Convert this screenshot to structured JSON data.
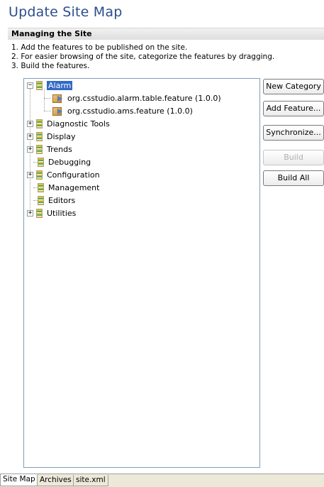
{
  "page": {
    "title": "Update Site Map"
  },
  "section": {
    "title": "Managing the Site",
    "instructions": [
      "1. Add the features to be published on the site.",
      "2. For easier browsing of the site, categorize the features by dragging.",
      "3. Build the features."
    ]
  },
  "tree": {
    "items": [
      {
        "label": "Alarm",
        "type": "category",
        "expander": "−",
        "selected": true
      },
      {
        "label": "org.csstudio.alarm.table.feature (1.0.0)",
        "type": "feature"
      },
      {
        "label": "org.csstudio.ams.feature (1.0.0)",
        "type": "feature"
      },
      {
        "label": "Diagnostic Tools",
        "type": "category",
        "expander": "+"
      },
      {
        "label": "Display",
        "type": "category",
        "expander": "+"
      },
      {
        "label": "Trends",
        "type": "category",
        "expander": "+"
      },
      {
        "label": "Debugging",
        "type": "category",
        "expander": ""
      },
      {
        "label": "Configuration",
        "type": "category",
        "expander": "+"
      },
      {
        "label": "Management",
        "type": "category",
        "expander": ""
      },
      {
        "label": "Editors",
        "type": "category",
        "expander": ""
      },
      {
        "label": "Utilities",
        "type": "category",
        "expander": "+"
      }
    ]
  },
  "buttons": {
    "new_category": "New Category",
    "add_feature": "Add Feature...",
    "synchronize": "Synchronize...",
    "build": "Build",
    "build_all": "Build All"
  },
  "tabs": [
    "Site Map",
    "Archives",
    "site.xml"
  ],
  "colors": {
    "title": "#2c4e8c",
    "selection": "#316ac5"
  }
}
